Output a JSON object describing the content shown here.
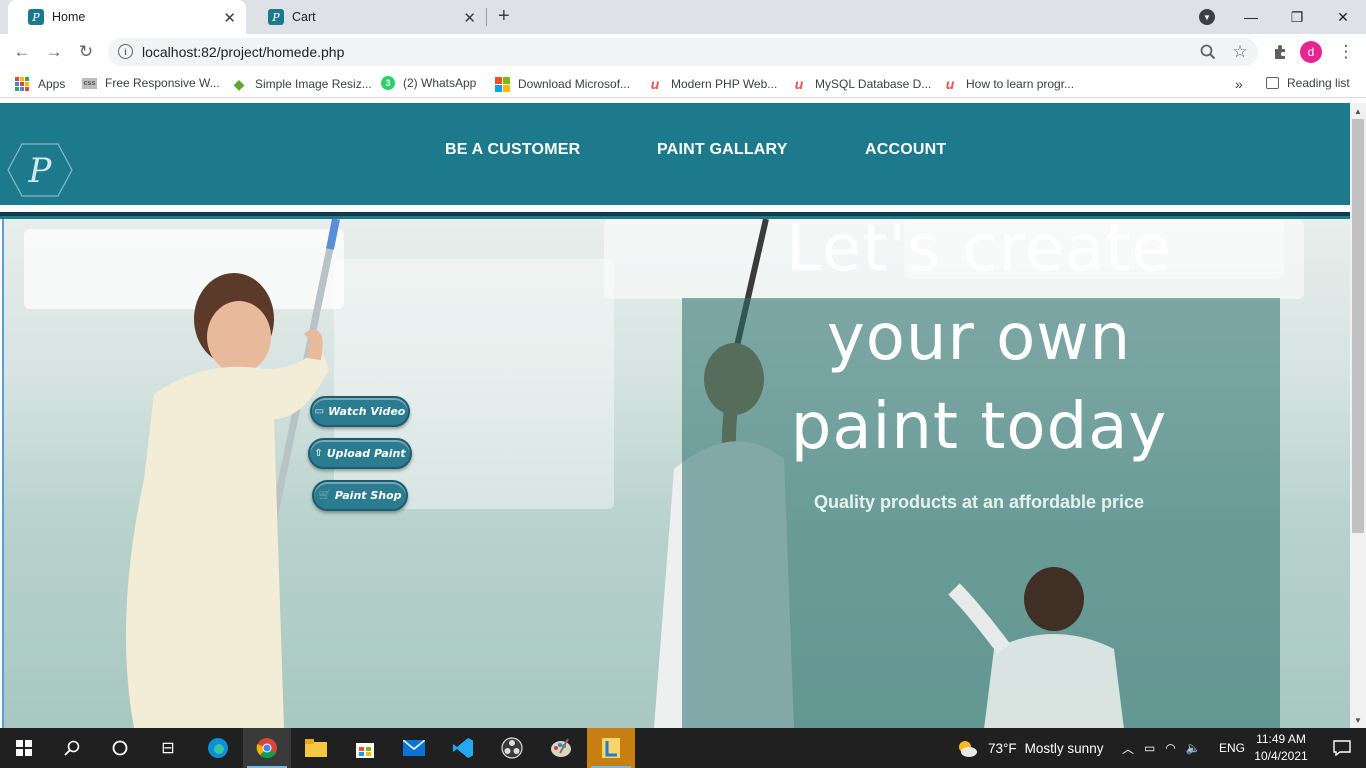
{
  "browser": {
    "tabs": [
      {
        "label": "Home",
        "favicon": "P",
        "active": true
      },
      {
        "label": "Cart",
        "favicon": "P",
        "active": false
      }
    ],
    "new_tab": "+",
    "url": "localhost:82/project/homede.php",
    "profile_initial": "d",
    "window_controls": {
      "minimize": "—",
      "restore": "❐",
      "close": "✕"
    },
    "bookmarks": [
      {
        "label": "Apps",
        "icon": "apps-grid-icon"
      },
      {
        "label": "Free Responsive W...",
        "icon": "css-icon"
      },
      {
        "label": "Simple Image Resiz...",
        "icon": "image-resizer-icon"
      },
      {
        "label": "(2) WhatsApp",
        "icon": "whatsapp-icon",
        "badge": "3"
      },
      {
        "label": "Download Microsof...",
        "icon": "microsoft-icon"
      },
      {
        "label": "Modern PHP Web...",
        "icon": "udemy-icon"
      },
      {
        "label": "MySQL Database D...",
        "icon": "udemy-icon"
      },
      {
        "label": "How to learn progr...",
        "icon": "udemy-icon"
      }
    ],
    "bookmarks_overflow": "»",
    "reading_list": "Reading list"
  },
  "site": {
    "nav": [
      "BE A CUSTOMER",
      "PAINT GALLARY",
      "ACCOUNT"
    ],
    "buttons": {
      "watch_video": "Watch Video",
      "upload_paint": "Upload Paint",
      "paint_shop": "Paint Shop"
    },
    "headline": [
      "Let's create",
      "your own",
      "paint today"
    ],
    "subline": "Quality products at an affordable price"
  },
  "colors": {
    "header_teal": "#1d7a8c",
    "dark_stripe": "#0e3d47",
    "button": "#2b7b91",
    "overlay": "#29706c"
  },
  "taskbar": {
    "weather_temp": "73°F",
    "weather_text": "Mostly sunny",
    "language": "ENG",
    "time": "11:49 AM",
    "date": "10/4/2021"
  }
}
